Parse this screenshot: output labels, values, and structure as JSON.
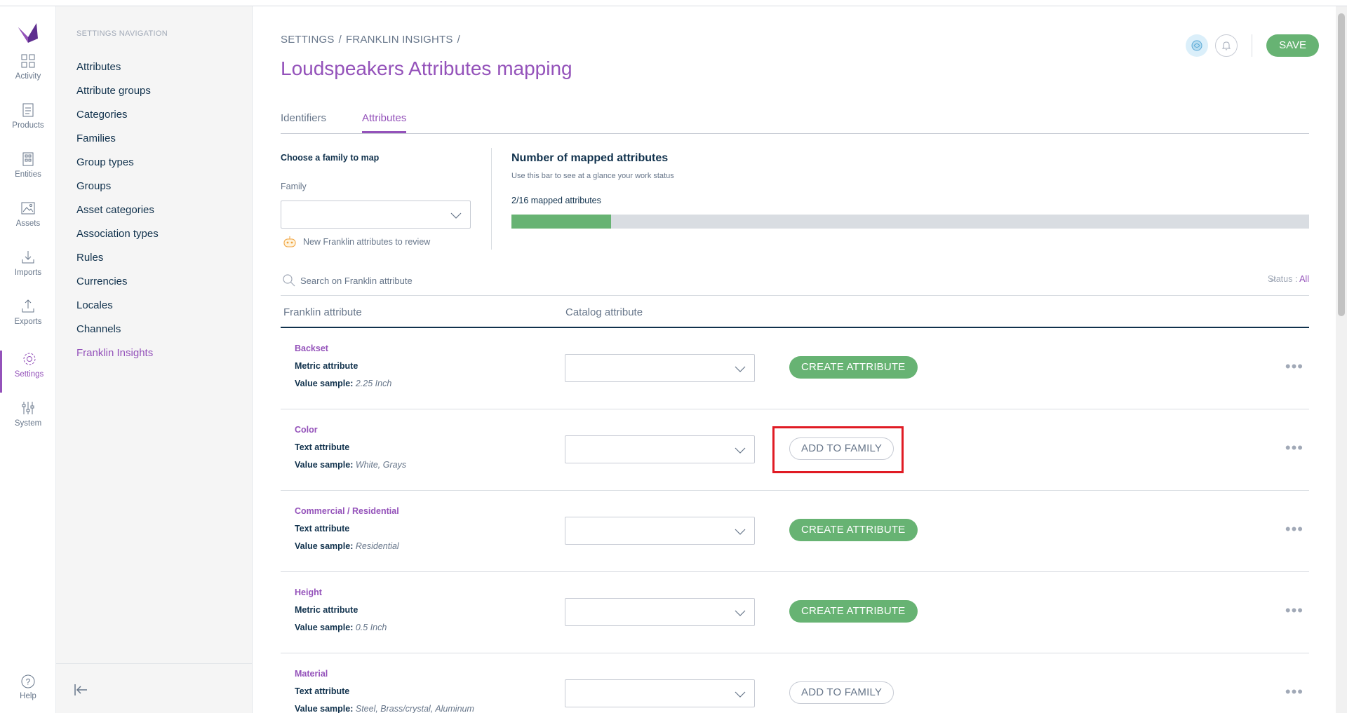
{
  "menu": {
    "items": [
      {
        "label": "Activity",
        "icon": "activity-icon"
      },
      {
        "label": "Products",
        "icon": "products-icon"
      },
      {
        "label": "Entities",
        "icon": "entities-icon"
      },
      {
        "label": "Assets",
        "icon": "assets-icon"
      },
      {
        "label": "Imports",
        "icon": "imports-icon"
      },
      {
        "label": "Exports",
        "icon": "exports-icon"
      },
      {
        "label": "Settings",
        "icon": "settings-icon"
      },
      {
        "label": "System",
        "icon": "system-icon"
      }
    ],
    "help_label": "Help"
  },
  "subnav": {
    "title": "SETTINGS NAVIGATION",
    "items": [
      "Attributes",
      "Attribute groups",
      "Categories",
      "Families",
      "Group types",
      "Groups",
      "Asset categories",
      "Association types",
      "Rules",
      "Currencies",
      "Locales",
      "Channels",
      "Franklin Insights"
    ],
    "active": "Franklin Insights"
  },
  "header": {
    "breadcrumb": [
      "SETTINGS",
      "/",
      "FRANKLIN INSIGHTS",
      "/"
    ],
    "title": "Loudspeakers Attributes mapping",
    "save_label": "SAVE"
  },
  "tabs": [
    "Identifiers",
    "Attributes"
  ],
  "active_tab": "Attributes",
  "family_panel": {
    "title": "Choose a family to map",
    "label": "Family",
    "value": "",
    "review_note": "New Franklin attributes to review"
  },
  "mapped": {
    "title": "Number of mapped attributes",
    "subtitle": "Use this bar to see at a glance your work status",
    "count_text": "2/16 mapped attributes",
    "mapped": 2,
    "total": 16
  },
  "search": {
    "placeholder": "Search on Franklin attribute",
    "status_label": "Status :",
    "status_value": "All"
  },
  "table": {
    "columns": [
      "Franklin attribute",
      "Catalog attribute"
    ],
    "value_sample_label": "Value sample:",
    "rows": [
      {
        "name": "Backset",
        "type": "Metric attribute",
        "sample": "2.25 Inch",
        "action": "CREATE ATTRIBUTE",
        "action_kind": "create"
      },
      {
        "name": "Color",
        "type": "Text attribute",
        "sample": "White, Grays",
        "action": "ADD TO FAMILY",
        "action_kind": "add"
      },
      {
        "name": "Commercial / Residential",
        "type": "Text attribute",
        "sample": "Residential",
        "action": "CREATE ATTRIBUTE",
        "action_kind": "create"
      },
      {
        "name": "Height",
        "type": "Metric attribute",
        "sample": "0.5 Inch",
        "action": "CREATE ATTRIBUTE",
        "action_kind": "create"
      },
      {
        "name": "Material",
        "type": "Text attribute",
        "sample": "Steel, Brass/crystal, Aluminum",
        "action": "ADD TO FAMILY",
        "action_kind": "add"
      }
    ],
    "more_glyph": "•••"
  },
  "colors": {
    "brand_purple": "#9452ba",
    "green": "#67b373",
    "highlight_red": "#e01b24"
  }
}
